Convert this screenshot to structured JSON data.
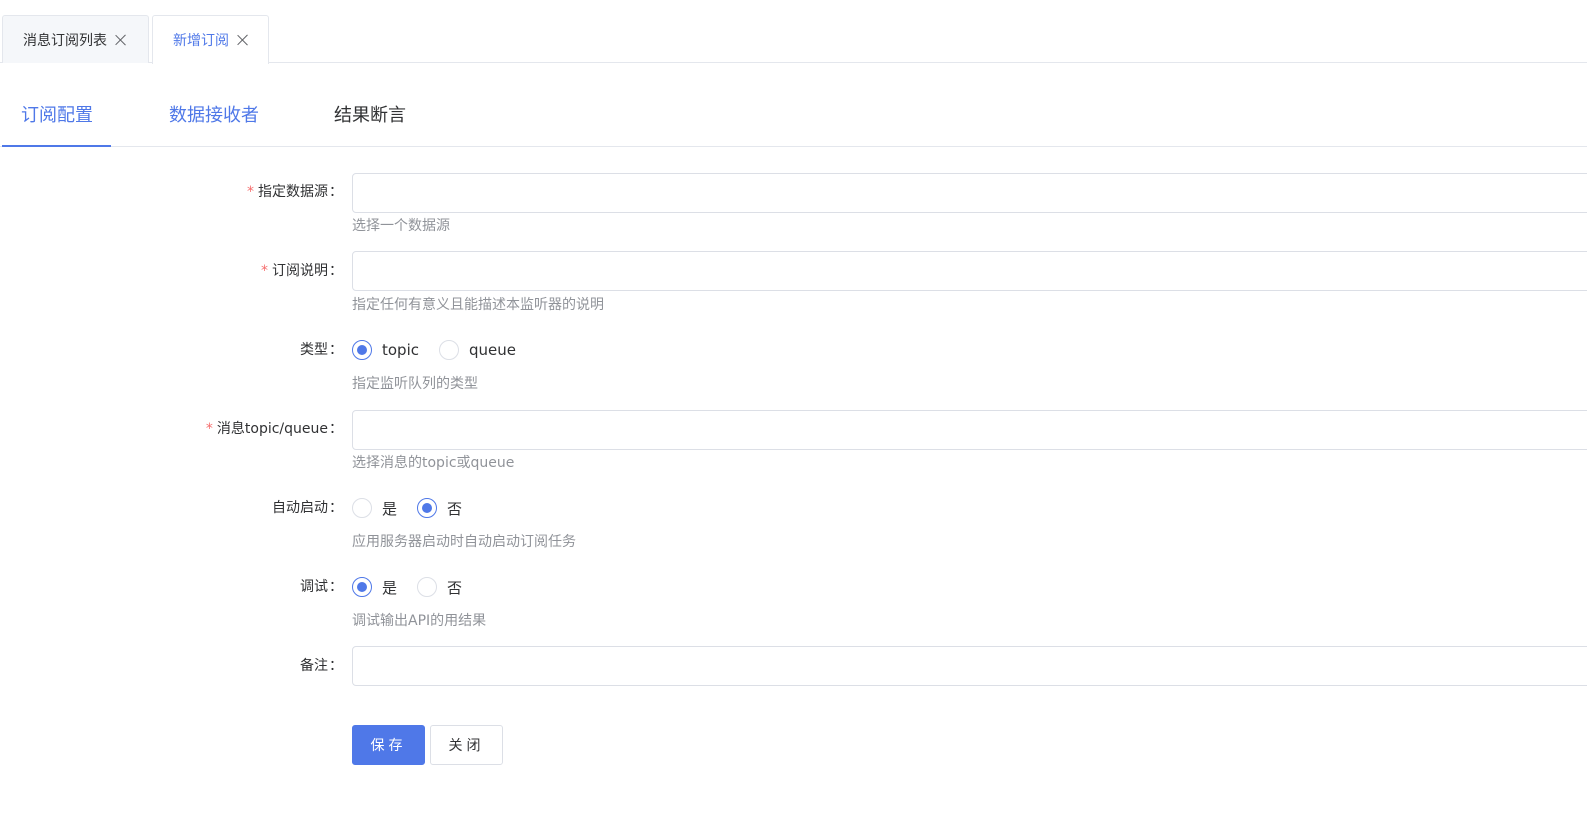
{
  "page_tabs": [
    {
      "label": "消息订阅列表",
      "active": false
    },
    {
      "label": "新增订阅",
      "active": true
    }
  ],
  "section_tabs": [
    {
      "label": "订阅配置",
      "active": true
    },
    {
      "label": "数据接收者",
      "active": false
    },
    {
      "label": "结果断言",
      "active": false
    }
  ],
  "form": {
    "datasource": {
      "label": "指定数据源",
      "required_mark": "*",
      "value": "",
      "help": "选择一个数据源"
    },
    "description": {
      "label": "订阅说明",
      "required_mark": "*",
      "value": "",
      "help": "指定任何有意义且能描述本监听器的说明"
    },
    "type": {
      "label": "类型",
      "options": [
        "topic",
        "queue"
      ],
      "selected": "topic",
      "help": "指定监听队列的类型"
    },
    "topic_queue": {
      "label": "消息topic/queue",
      "required_mark": "*",
      "value": "",
      "help": "选择消息的topic或queue"
    },
    "auto_start": {
      "label": "自动启动",
      "options": [
        "是",
        "否"
      ],
      "selected": "否",
      "help": "应用服务器启动时自动启动订阅任务"
    },
    "debug": {
      "label": "调试",
      "options": [
        "是",
        "否"
      ],
      "selected": "是",
      "help": "调试输出API的用结果"
    },
    "remark": {
      "label": "备注",
      "value": ""
    },
    "colon": "："
  },
  "buttons": {
    "save": "保存",
    "close": "关闭"
  },
  "colors": {
    "primary": "#4f78e8",
    "required": "#f56c6c",
    "help_text": "#909399",
    "border": "#dcdfe6"
  }
}
